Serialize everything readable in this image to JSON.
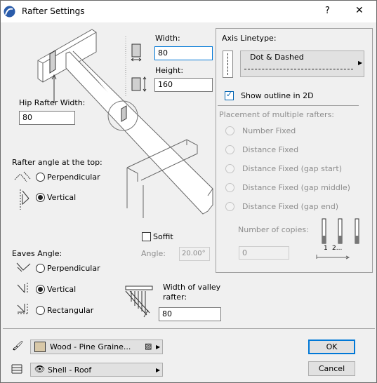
{
  "title": "Rafter Settings",
  "titlebar": {
    "help": "?",
    "close": "✕"
  },
  "dimensions": {
    "width_label": "Width:",
    "width_value": "80",
    "height_label": "Height:",
    "height_value": "160",
    "hip_label": "Hip Rafter Width:",
    "hip_value": "80"
  },
  "axis": {
    "label": "Axis Linetype:",
    "linetype": "Dot & Dashed",
    "show_outline_label": "Show outline in 2D",
    "show_outline_checked": true
  },
  "placement": {
    "label": "Placement of multiple rafters:",
    "options": [
      "Number Fixed",
      "Distance Fixed",
      "Distance Fixed (gap start)",
      "Distance Fixed (gap middle)",
      "Distance Fixed (gap end)"
    ],
    "copies_label": "Number of copies:",
    "copies_value": "0",
    "diagram_labels": [
      "1",
      "2..."
    ]
  },
  "top_angle": {
    "label": "Rafter angle at the top:",
    "options": [
      "Perpendicular",
      "Vertical"
    ],
    "selected": "Vertical"
  },
  "soffit": {
    "label": "Soffit",
    "checked": false,
    "angle_label": "Angle:",
    "angle_value": "20.00°"
  },
  "eaves": {
    "label": "Eaves Angle:",
    "options": [
      "Perpendicular",
      "Vertical",
      "Rectangular"
    ],
    "selected": "Vertical"
  },
  "valley": {
    "label_line1": "Width of valley",
    "label_line2": "rafter:",
    "value": "80"
  },
  "material": {
    "value": "Wood - Pine Graine...",
    "swatch": "#d8c8a8"
  },
  "layer": {
    "value": "Shell - Roof"
  },
  "buttons": {
    "ok": "OK",
    "cancel": "Cancel"
  },
  "colors": {
    "accent": "#0078d7"
  }
}
